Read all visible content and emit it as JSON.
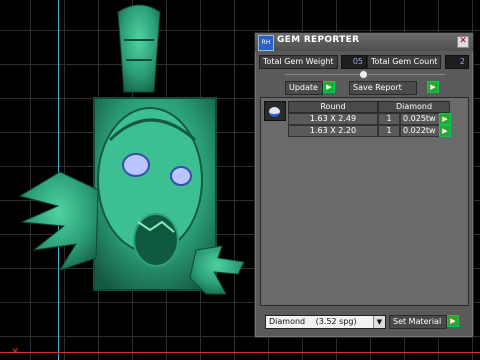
{
  "window": {
    "title": "GEM REPORTER",
    "logo_text": "RH"
  },
  "weight": {
    "label": "Total Gem Weight",
    "value": "05"
  },
  "count": {
    "label": "Total Gem Count",
    "value": "2"
  },
  "buttons": {
    "update": "Update",
    "save_report": "Save Report",
    "set_material": "Set Material"
  },
  "table": {
    "columns": [
      "Round",
      "Diamond"
    ],
    "rows": [
      {
        "size": "1.63 X 2.49",
        "qty": "1",
        "weight": "0.025tw"
      },
      {
        "size": "1.63 X 2.20",
        "qty": "1",
        "weight": "0.022tw"
      }
    ]
  },
  "material": {
    "selected": "Diamond",
    "density": "(3.52 spg)"
  },
  "colors": {
    "accent_green": "#2fa52f",
    "model_green": "#2fa07a",
    "axis_vertical": "#3fb4c9",
    "axis_horizontal": "#cc3333"
  },
  "icons": {
    "close": "close-icon",
    "go": "green-arrow-icon",
    "gem": "round-diamond-icon",
    "logo": "app-logo-icon"
  }
}
